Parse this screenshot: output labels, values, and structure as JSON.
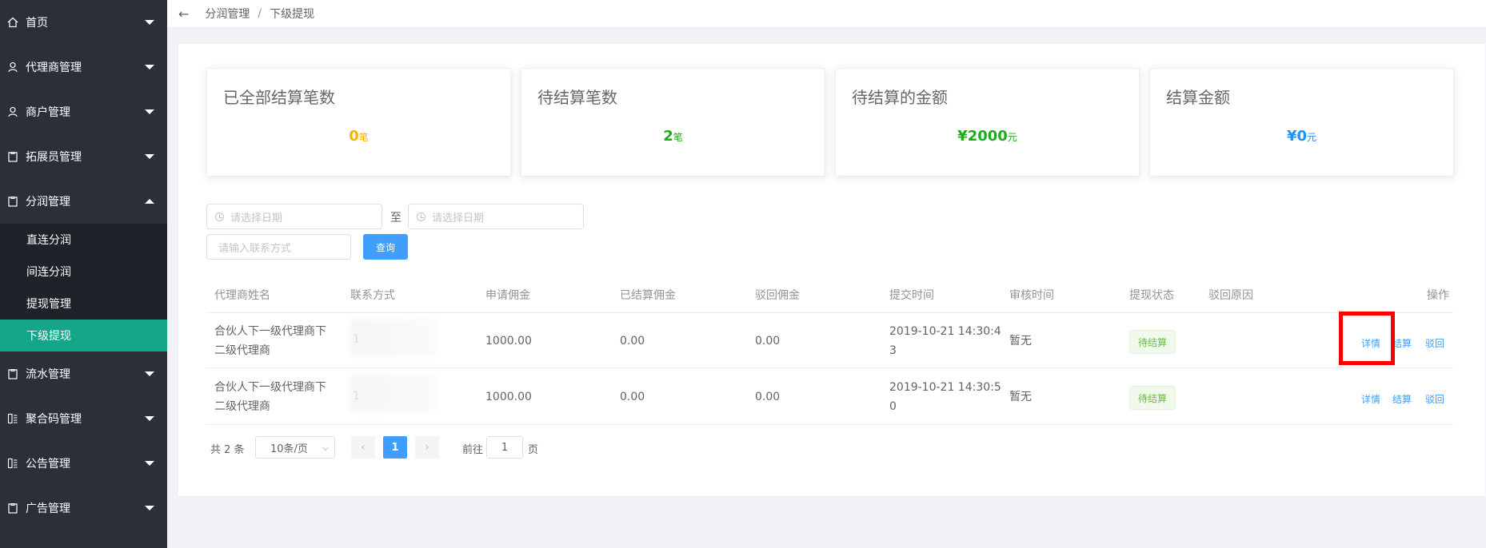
{
  "sidebar": {
    "menu": [
      {
        "label": "首页",
        "icon": "home-icon",
        "expanded": false
      },
      {
        "label": "代理商管理",
        "icon": "user-icon",
        "expanded": false
      },
      {
        "label": "商户管理",
        "icon": "user-icon",
        "expanded": false
      },
      {
        "label": "拓展员管理",
        "icon": "clipboard-icon",
        "expanded": false
      },
      {
        "label": "分润管理",
        "icon": "clipboard-icon",
        "expanded": true
      }
    ],
    "submenu": [
      {
        "label": "直连分润"
      },
      {
        "label": "间连分润"
      },
      {
        "label": "提现管理"
      },
      {
        "label": "下级提现",
        "active": true
      }
    ],
    "menu_after": [
      {
        "label": "流水管理",
        "icon": "clipboard-icon"
      },
      {
        "label": "聚合码管理",
        "icon": "grid-icon"
      },
      {
        "label": "公告管理",
        "icon": "grid-icon"
      },
      {
        "label": "广告管理",
        "icon": "clipboard-icon"
      }
    ]
  },
  "breadcrumb": {
    "back": "←",
    "parent": "分润管理",
    "sep": "/",
    "current": "下级提现"
  },
  "stats": [
    {
      "title": "已全部结算笔数",
      "value": "0",
      "unit": "笔",
      "color": "#f5b400"
    },
    {
      "title": "待结算笔数",
      "value": "2",
      "unit": "笔",
      "color": "#1aad19"
    },
    {
      "title": "待结算的金额",
      "value": "¥2000",
      "unit": "元",
      "color": "#1aad19"
    },
    {
      "title": "结算金额",
      "value": "¥0",
      "unit": "元",
      "color": "#1e90ff"
    }
  ],
  "filters": {
    "start_date_placeholder": "请选择日期",
    "to_label": "至",
    "end_date_placeholder": "请选择日期",
    "contact_placeholder": "请输入联系方式",
    "query_label": "查询"
  },
  "table": {
    "headers": [
      "代理商姓名",
      "联系方式",
      "申请佣金",
      "已结算佣金",
      "驳回佣金",
      "提交时间",
      "审核时间",
      "提现状态",
      "驳回原因",
      "操作"
    ],
    "rows": [
      {
        "name_line1": "合伙人下一级代理商下",
        "name_line2": "二级代理商",
        "contact": "1",
        "apply": "1000.00",
        "settled": "0.00",
        "rejected": "0.00",
        "submit_line1": "2019-10-21 14:30:4",
        "submit_line2": "3",
        "audit": "暂无",
        "status": "待结算",
        "reason": ""
      },
      {
        "name_line1": "合伙人下一级代理商下",
        "name_line2": "二级代理商",
        "contact": "1",
        "apply": "1000.00",
        "settled": "0.00",
        "rejected": "0.00",
        "submit_line1": "2019-10-21 14:30:5",
        "submit_line2": "0",
        "audit": "暂无",
        "status": "待结算",
        "reason": ""
      }
    ],
    "ops": {
      "detail": "详情",
      "settle": "结算",
      "reject": "驳回"
    }
  },
  "pagination": {
    "total": "共 2 条",
    "page_size": "10条/页",
    "prev": "‹",
    "current": "1",
    "next": "›",
    "goto_label": "前往",
    "goto_value": "1",
    "page_suffix": "页"
  }
}
